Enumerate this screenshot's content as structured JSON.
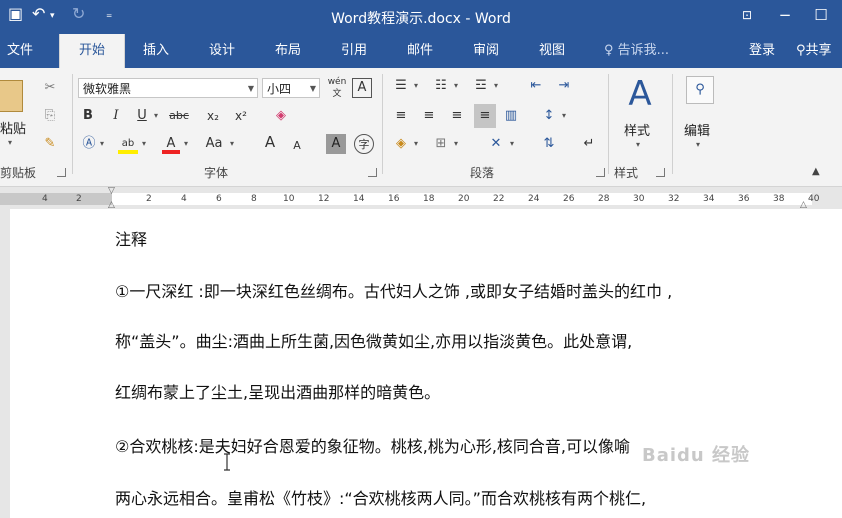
{
  "window": {
    "title": "Word教程演示.docx - Word"
  },
  "quick_access": {
    "save_icon": "save-icon",
    "undo_icon": "undo-icon",
    "redo_icon": "redo-icon",
    "customize_icon": "customize-icon"
  },
  "window_controls": {
    "restore": "ribbon-display-icon",
    "minimize": "minimize-icon",
    "maximize": "maximize-icon"
  },
  "tabs": [
    {
      "label": "文件"
    },
    {
      "label": "开始"
    },
    {
      "label": "插入"
    },
    {
      "label": "设计"
    },
    {
      "label": "布局"
    },
    {
      "label": "引用"
    },
    {
      "label": "邮件"
    },
    {
      "label": "审阅"
    },
    {
      "label": "视图"
    }
  ],
  "tell_me": {
    "label": "告诉我..."
  },
  "account": {
    "signin": "登录",
    "share": "共享"
  },
  "ribbon": {
    "clipboard": {
      "label": "剪贴板",
      "paste": "粘贴"
    },
    "font": {
      "label": "字体",
      "font_name": "微软雅黑",
      "font_size": "小四",
      "bold": "B",
      "italic": "I",
      "underline": "U",
      "strike": "abc",
      "subscript": "x₂",
      "superscript": "x²",
      "change_case": "Aa",
      "grow": "A",
      "shrink": "A",
      "phonetic": "wén",
      "char_border": "A",
      "char_shading": "A",
      "enclose": "字"
    },
    "paragraph": {
      "label": "段落"
    },
    "styles": {
      "label": "样式",
      "button": "样式"
    },
    "editing": {
      "label": "编辑",
      "button": "编辑"
    }
  },
  "ruler": {
    "left_numbers": [
      "4",
      "2"
    ],
    "numbers": [
      "2",
      "4",
      "6",
      "8",
      "10",
      "12",
      "14",
      "16",
      "18",
      "20",
      "22",
      "24",
      "26",
      "28",
      "30",
      "32",
      "34",
      "36",
      "38",
      "40"
    ]
  },
  "document": {
    "heading": "注释",
    "lines": [
      "①一尺深红 :即一块深红色丝绸布。古代妇人之饰 ,或即女子结婚时盖头的红巾 ,",
      "称“盖头”。曲尘:酒曲上所生菌,因色微黄如尘,亦用以指淡黄色。此处意谓,",
      "红绸布蒙上了尘土,呈现出酒曲那样的暗黄色。",
      "②合欢桃核:是夫妇好合恩爱的象征物。桃核,桃为心形,核同合音,可以像喻",
      "两心永远相合。皇甫松《竹枝》:“合欢桃核两人同。”而合欢桃核有两个桃仁,"
    ]
  },
  "watermark": {
    "text": "Baidu 经验"
  }
}
